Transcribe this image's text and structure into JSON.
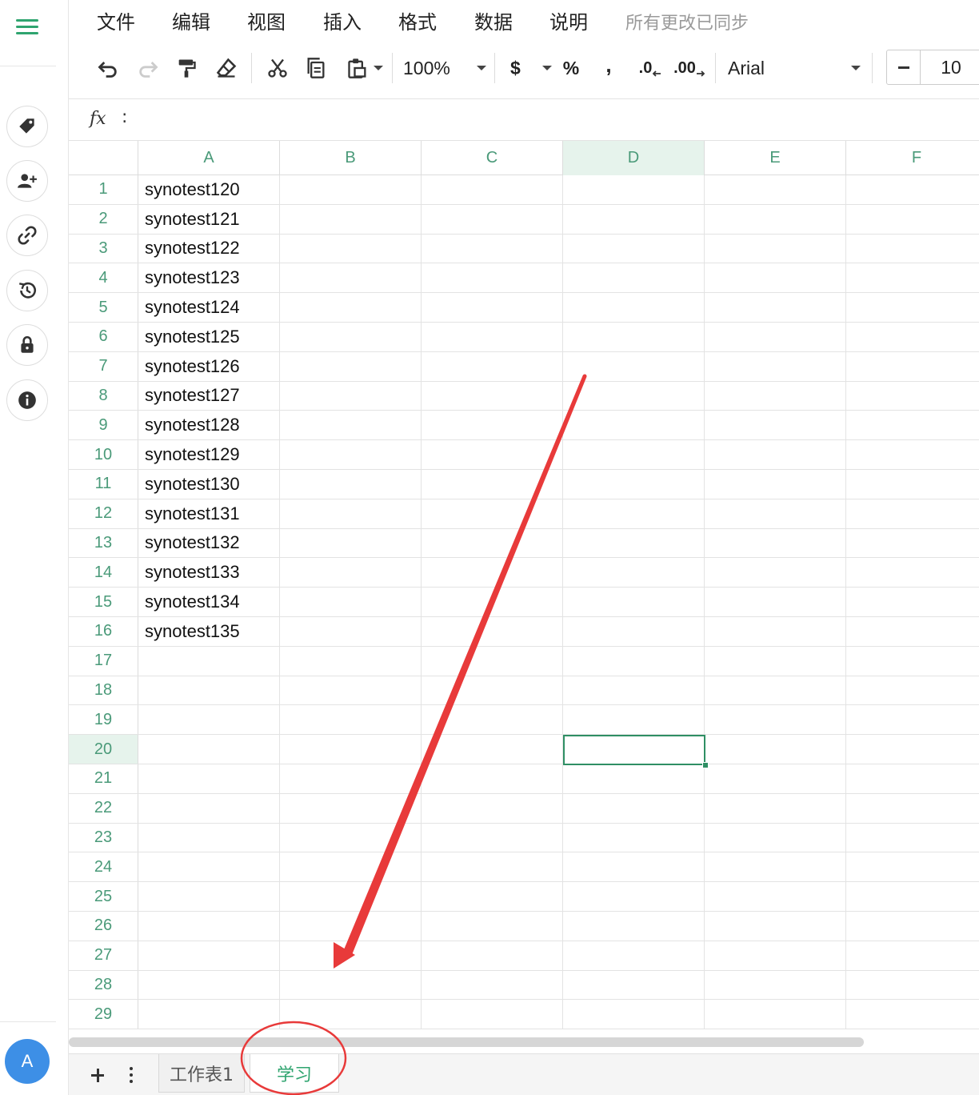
{
  "menu": {
    "items": [
      "文件",
      "编辑",
      "视图",
      "插入",
      "格式",
      "数据",
      "说明"
    ],
    "sync_status": "所有更改已同步"
  },
  "toolbar": {
    "zoom": "100%",
    "currency_symbol": "$",
    "percent_symbol": "%",
    "comma_symbol": ",",
    "decrease_decimal": ".0",
    "increase_decimal": ".00",
    "font_family": "Arial",
    "font_size": "10"
  },
  "formula_bar": {
    "label": "fx",
    "colon": ":",
    "value": ""
  },
  "grid": {
    "columns": [
      "A",
      "B",
      "C",
      "D",
      "E",
      "F"
    ],
    "selected_column": "D",
    "selected_row": 20,
    "rows": [
      {
        "num": "1",
        "a": "synotest120"
      },
      {
        "num": "2",
        "a": "synotest121"
      },
      {
        "num": "3",
        "a": "synotest122"
      },
      {
        "num": "4",
        "a": "synotest123"
      },
      {
        "num": "5",
        "a": "synotest124"
      },
      {
        "num": "6",
        "a": "synotest125"
      },
      {
        "num": "7",
        "a": "synotest126"
      },
      {
        "num": "8",
        "a": "synotest127"
      },
      {
        "num": "9",
        "a": "synotest128"
      },
      {
        "num": "10",
        "a": "synotest129"
      },
      {
        "num": "11",
        "a": "synotest130"
      },
      {
        "num": "12",
        "a": "synotest131"
      },
      {
        "num": "13",
        "a": "synotest132"
      },
      {
        "num": "14",
        "a": "synotest133"
      },
      {
        "num": "15",
        "a": "synotest134"
      },
      {
        "num": "16",
        "a": "synotest135"
      },
      {
        "num": "17",
        "a": ""
      },
      {
        "num": "18",
        "a": ""
      },
      {
        "num": "19",
        "a": ""
      },
      {
        "num": "20",
        "a": ""
      },
      {
        "num": "21",
        "a": ""
      },
      {
        "num": "22",
        "a": ""
      },
      {
        "num": "23",
        "a": ""
      },
      {
        "num": "24",
        "a": ""
      },
      {
        "num": "25",
        "a": ""
      },
      {
        "num": "26",
        "a": ""
      },
      {
        "num": "27",
        "a": ""
      },
      {
        "num": "28",
        "a": ""
      },
      {
        "num": "29",
        "a": ""
      }
    ]
  },
  "sheets": [
    {
      "name": "工作表1",
      "active": false
    },
    {
      "name": "学习",
      "active": true
    }
  ],
  "user": {
    "avatar_initial": "A"
  },
  "colors": {
    "accent": "#2fa46f",
    "header_text": "#4a9a79",
    "selection": "#2f8f64",
    "annotation": "#e83a3a",
    "avatar": "#3d8fe6"
  },
  "icons": [
    "menu-icon",
    "tag-icon",
    "add-user-icon",
    "link-icon",
    "history-icon",
    "lock-icon",
    "info-icon",
    "undo-icon",
    "redo-icon",
    "paint-format-icon",
    "eraser-icon",
    "cut-icon",
    "copy-icon",
    "paste-icon"
  ]
}
